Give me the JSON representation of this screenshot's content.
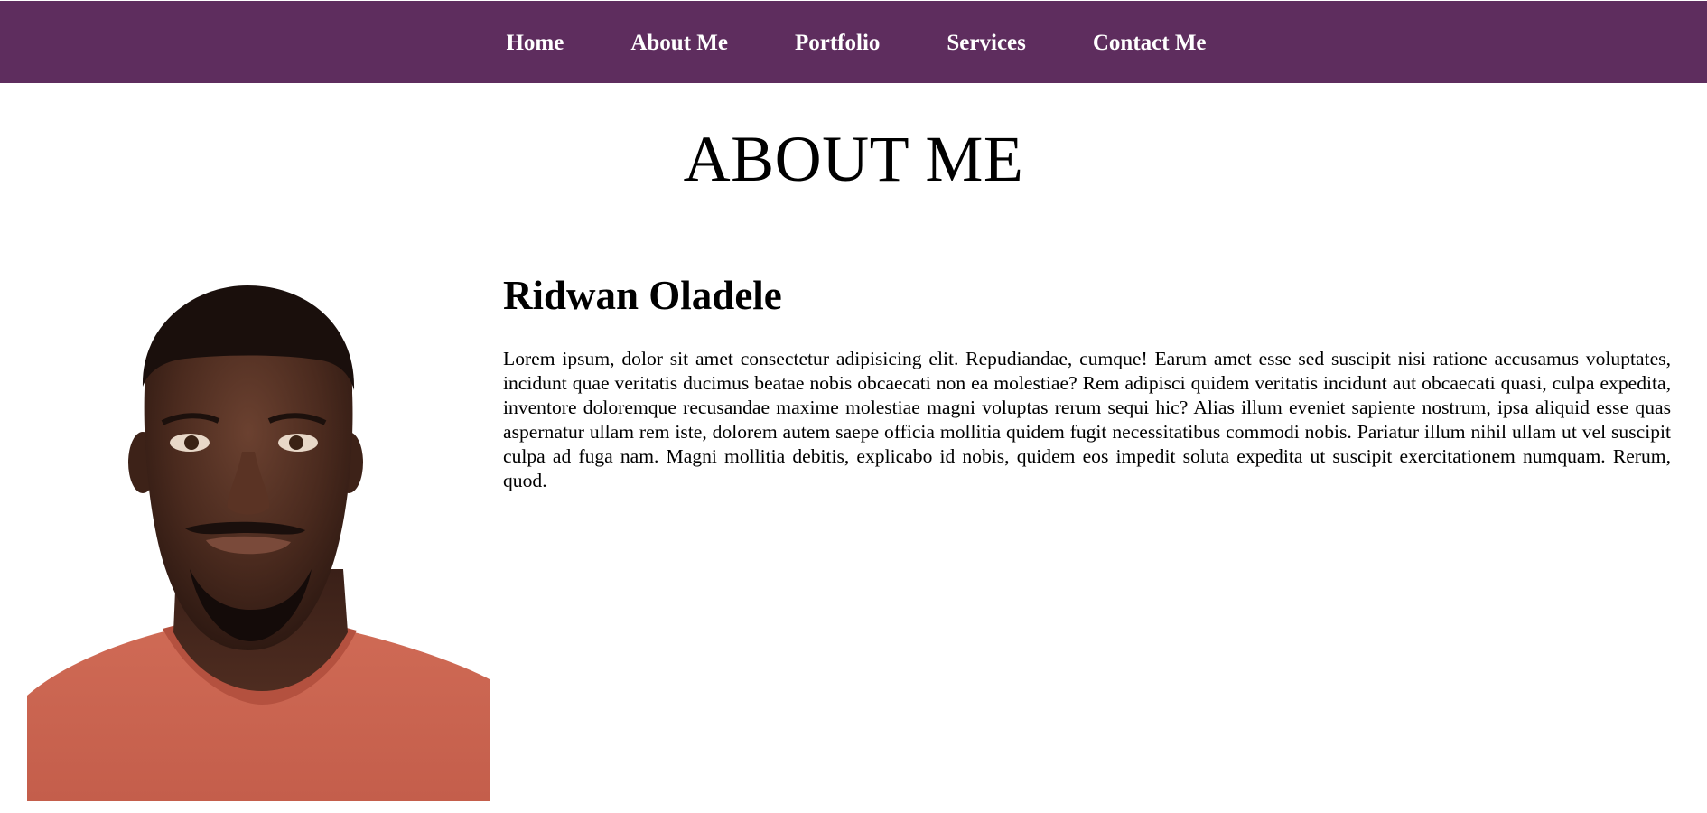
{
  "nav": {
    "items": [
      {
        "label": "Home"
      },
      {
        "label": "About Me"
      },
      {
        "label": "Portfolio"
      },
      {
        "label": "Services"
      },
      {
        "label": "Contact Me"
      }
    ],
    "background_color": "#5e2d5e"
  },
  "page": {
    "title": "ABOUT ME"
  },
  "profile": {
    "name": "Ridwan Oladele",
    "bio": "Lorem ipsum, dolor sit amet consectetur adipisicing elit. Repudiandae, cumque! Earum amet esse sed suscipit nisi ratione accusamus voluptates, incidunt quae veritatis ducimus beatae nobis obcaecati non ea molestiae? Rem adipisci quidem veritatis incidunt aut obcaecati quasi, culpa expedita, inventore doloremque recusandae maxime molestiae magni voluptas rerum sequi hic? Alias illum eveniet sapiente nostrum, ipsa aliquid esse quas aspernatur ullam rem iste, dolorem autem saepe officia mollitia quidem fugit necessitatibus commodi nobis. Pariatur illum nihil ullam ut vel suscipit culpa ad fuga nam. Magni mollitia debitis, explicabo id nobis, quidem eos impedit soluta expedita ut suscipit exercitationem numquam. Rerum, quod."
  }
}
